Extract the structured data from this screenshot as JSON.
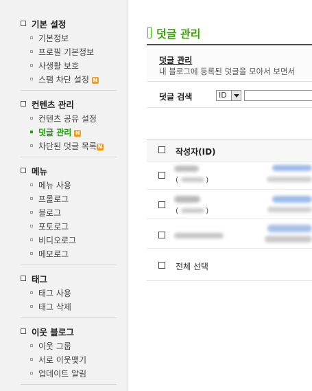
{
  "sidebar": {
    "sections": [
      {
        "title": "기본 설정",
        "items": [
          {
            "label": "기본정보"
          },
          {
            "label": "프로필 기본정보"
          },
          {
            "label": "사생활 보호"
          },
          {
            "label": "스팸 차단 설정",
            "badge": "N"
          }
        ]
      },
      {
        "title": "컨텐츠 관리",
        "items": [
          {
            "label": "컨텐츠 공유 설정"
          },
          {
            "label": "덧글 관리",
            "badge": "N",
            "active": true
          },
          {
            "label": "차단된 덧글 목록",
            "badge": "N"
          }
        ]
      },
      {
        "title": "메뉴",
        "items": [
          {
            "label": "메뉴 사용"
          },
          {
            "label": "프롤로그"
          },
          {
            "label": "블로그"
          },
          {
            "label": "포토로그"
          },
          {
            "label": "비디오로그"
          },
          {
            "label": "메모로그"
          }
        ]
      },
      {
        "title": "태그",
        "items": [
          {
            "label": "태그 사용"
          },
          {
            "label": "태그 삭제"
          }
        ]
      },
      {
        "title": "이웃 블로그",
        "items": [
          {
            "label": "이웃 그룹"
          },
          {
            "label": "서로 이웃맺기"
          },
          {
            "label": "업데이트 알림"
          }
        ]
      }
    ]
  },
  "main": {
    "title": "덧글 관리",
    "info": {
      "title": "덧글 관리",
      "desc": "내 블로그에 등록된 덧글을 모아서 보면서"
    },
    "search": {
      "label": "덧글 검색",
      "field_selected": "ID",
      "value": ""
    },
    "table": {
      "header_author": "작성자(ID)",
      "paren_open": "(",
      "paren_close": ")"
    },
    "select_all": "전체 선택"
  },
  "colors": {
    "accent_green": "#3aa500",
    "badge_orange": "#f29b1e",
    "sidebar_bg": "#f2f2f2"
  }
}
